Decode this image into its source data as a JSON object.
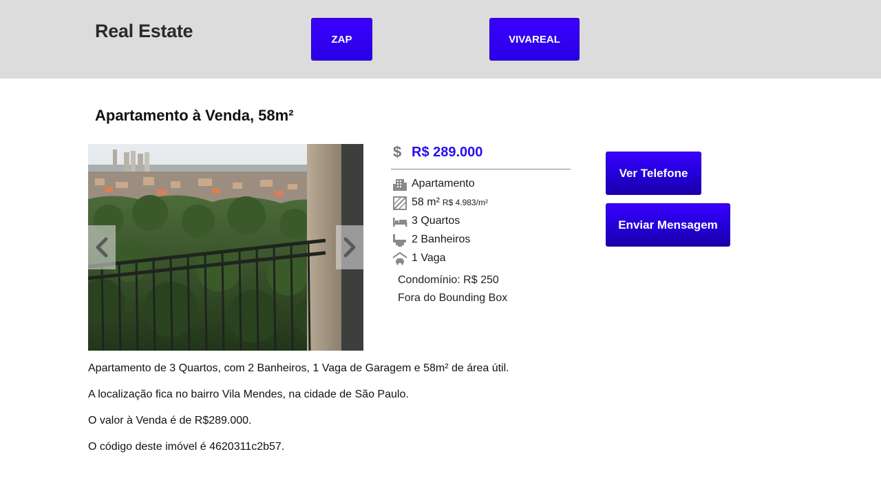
{
  "header": {
    "brand": "Real Estate",
    "links": [
      "ZAP",
      "VIVAREAL"
    ]
  },
  "listing": {
    "title": "Apartamento à Venda, 58m²",
    "price": "R$ 289.000",
    "features": [
      {
        "icon": "building-icon",
        "text": "Apartamento",
        "sub": ""
      },
      {
        "icon": "area-icon",
        "text": "58 m²",
        "sub": "R$ 4.983/m²"
      },
      {
        "icon": "bed-icon",
        "text": "3 Quartos",
        "sub": ""
      },
      {
        "icon": "bathroom-icon",
        "text": "2 Banheiros",
        "sub": ""
      },
      {
        "icon": "garage-icon",
        "text": "1 Vaga",
        "sub": ""
      }
    ],
    "condominio": "Condomínio: R$ 250",
    "extra_note": "Fora do Bounding Box"
  },
  "actions": {
    "phone": "Ver Telefone",
    "message": "Enviar Mensagem"
  },
  "description": [
    "Apartamento de 3 Quartos, com 2 Banheiros, 1 Vaga de Garagem e 58m² de área útil.",
    "A localização fica no bairro Vila Mendes, na cidade de São Paulo.",
    "O valor à Venda é de R$289.000.",
    "O código deste imóvel é 4620311c2b57."
  ],
  "colors": {
    "accent": "#2a0df0",
    "header_bg": "#dcdcdc"
  }
}
